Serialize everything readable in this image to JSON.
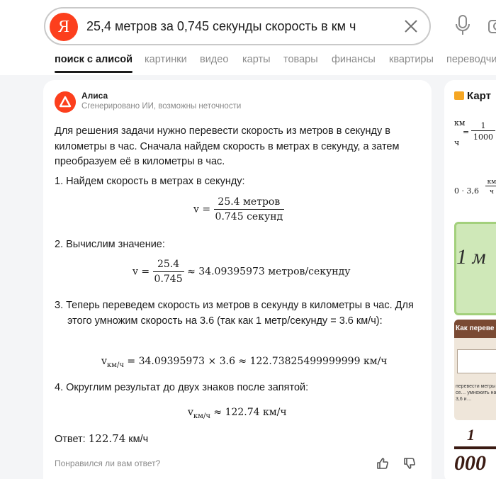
{
  "search": {
    "query": "25,4 метров за 0,745 секунды скорость в км ч",
    "logo_letter": "Я"
  },
  "tabs": [
    {
      "label": "поиск с алисой",
      "active": true
    },
    {
      "label": "картинки"
    },
    {
      "label": "видео"
    },
    {
      "label": "карты"
    },
    {
      "label": "товары"
    },
    {
      "label": "финансы"
    },
    {
      "label": "квартиры"
    },
    {
      "label": "переводчик"
    }
  ],
  "answer": {
    "author": "Алиса",
    "disclaimer": "Сгенерировано ИИ, возможны неточности",
    "intro": "Для решения задачи нужно перевести скорость из метров в секунду в километры в час. Сначала найдем скорость в метрах в секунду, а затем преобразуем её в километры в час.",
    "step1": "1. Найдем скорость в метрах в секунду:",
    "formula1": {
      "lhs": "v =",
      "num": "25.4 метров",
      "den": "0.745 секунд"
    },
    "step2": "2. Вычислим значение:",
    "formula2": {
      "lhs": "v =",
      "num": "25.4",
      "den": "0.745",
      "rhs": "≈ 34.09395973 метров/секунду"
    },
    "step3": "3. Теперь переведем скорость из метров в секунду в километры в час. Для этого умножим скорость на 3.6 (так как 1 метр/секунду = 3.6 км/ч):",
    "formula3": {
      "v": "v",
      "sub": "км/ч",
      "rhs": " = 34.09395973 × 3.6 ≈ 122.73825499999999 км/ч"
    },
    "step4": "4. Округлим результат до двух знаков после запятой:",
    "formula4": {
      "v": "v",
      "sub": "км/ч",
      "rhs": " ≈ 122.74 км/ч"
    },
    "result_label": "Ответ: ",
    "result_value": "122.74",
    "result_unit": " км/ч",
    "feedback": "Понравился ли вам ответ?"
  },
  "sidebar": {
    "title": "Карт",
    "thumb1": {
      "a": "км",
      "b": "ч",
      "eq": "=",
      "num": "1",
      "den": "1000"
    },
    "thumb2": {
      "text": "0 · 3,6",
      "num": "км",
      "den": "ч",
      "eq": "="
    },
    "thumb3": {
      "text": "1 м"
    },
    "thumb4": {
      "title": "Как переве",
      "note": "перевести метры в се… умножить на 3,6 и…"
    },
    "thumb5": {
      "num": "1",
      "den": "000"
    }
  },
  "colors": {
    "brand": "#fc3f1d",
    "muted": "#8a8a8a",
    "text": "#1a1a1a"
  }
}
